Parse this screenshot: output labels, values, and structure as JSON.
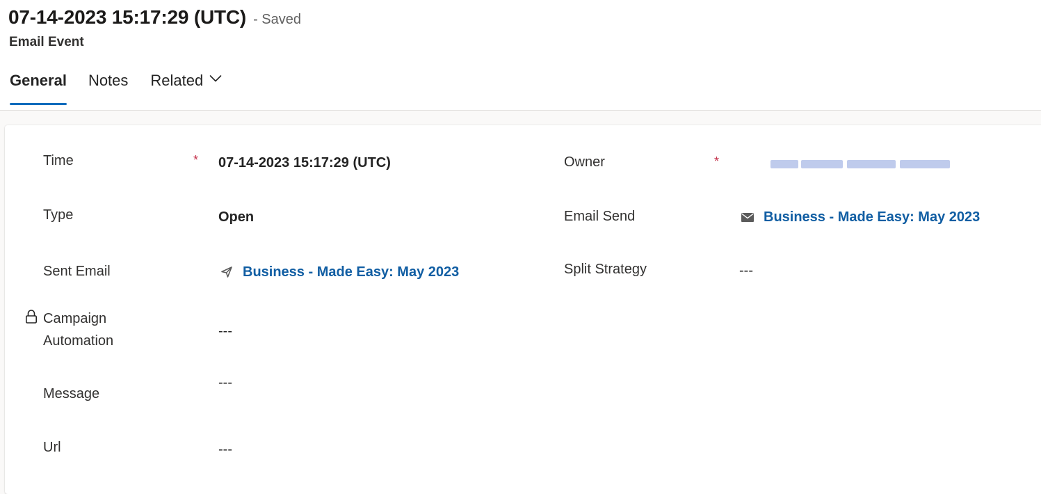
{
  "header": {
    "title": "07-14-2023 15:17:29 (UTC)",
    "save_status": "- Saved",
    "entity": "Email Event"
  },
  "tabs": [
    {
      "label": "General",
      "selected": true
    },
    {
      "label": "Notes",
      "selected": false
    },
    {
      "label": "Related",
      "selected": false
    }
  ],
  "fields": {
    "time": {
      "label": "Time",
      "required_marker": "*",
      "value": "07-14-2023 15:17:29 (UTC)"
    },
    "type": {
      "label": "Type",
      "value": "Open"
    },
    "sent_email": {
      "label": "Sent Email",
      "value": "Business - Made Easy: May 2023",
      "icon": "send-icon"
    },
    "campaign_automation": {
      "label_line1": "Campaign",
      "label_line2": "Automation",
      "value": "---",
      "icon": "lock-icon"
    },
    "message": {
      "label": "Message",
      "value": "---"
    },
    "url": {
      "label": "Url",
      "value": "---"
    },
    "owner": {
      "label": "Owner",
      "required_marker": "*"
    },
    "email_send": {
      "label": "Email Send",
      "value": "Business - Made Easy: May 2023",
      "icon": "mail-icon"
    },
    "split_strategy": {
      "label": "Split Strategy",
      "value": "---"
    }
  },
  "colors": {
    "accent": "#0f6cbd",
    "link": "#115ea3",
    "required": "#c4314b"
  }
}
